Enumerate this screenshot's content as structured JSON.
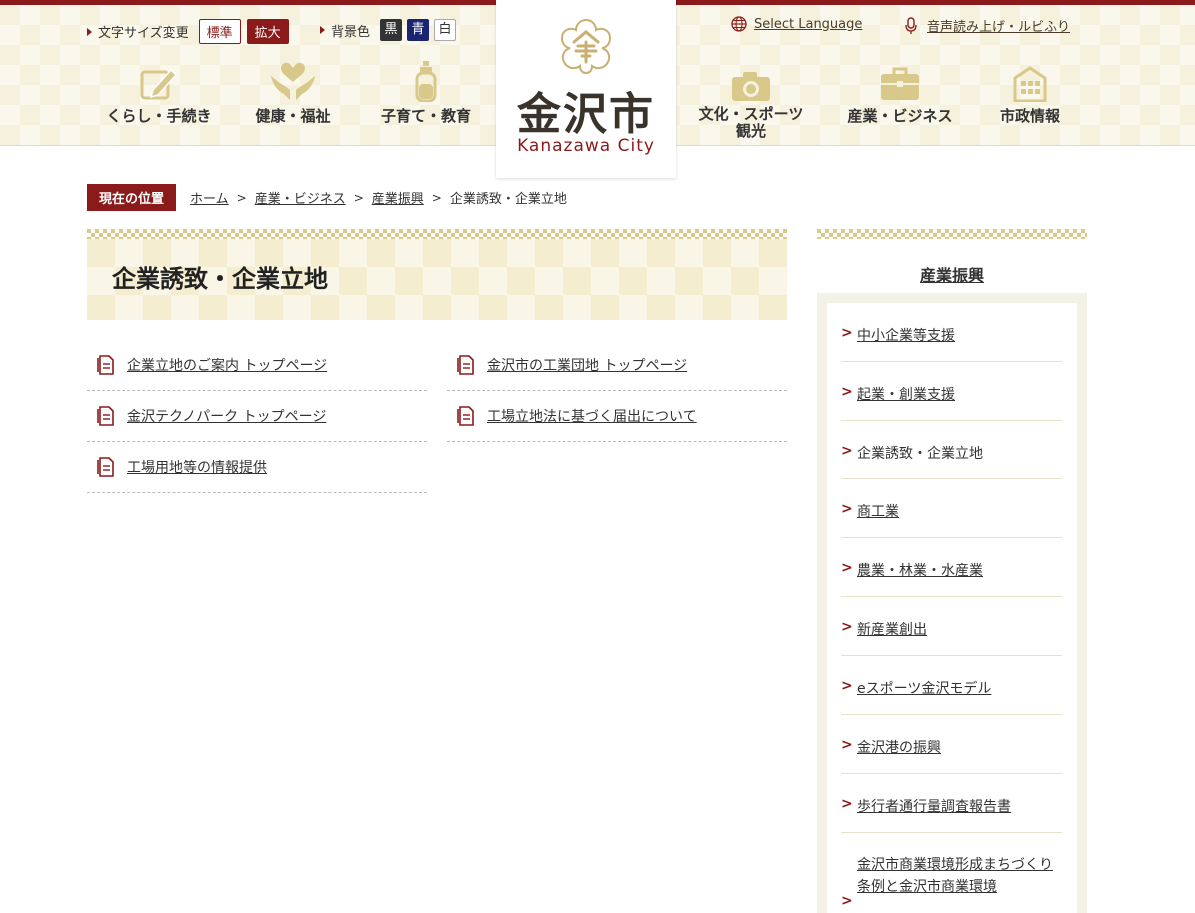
{
  "colors": {
    "accent": "#8b1a1a",
    "navy": "#1a2470",
    "gold": "#d8c88a"
  },
  "header": {
    "font_size_label": "文字サイズ変更",
    "font_size_standard": "標準",
    "font_size_large": "拡大",
    "bg_color_label": "背景色",
    "bg_black": "黒",
    "bg_blue": "青",
    "bg_white": "白",
    "select_language": "Select Language",
    "voice_reading": "音声読み上げ・ルビふり",
    "logo_name": "金沢市",
    "logo_sub": "Kanazawa City",
    "nav": [
      {
        "label": "くらし・手続き",
        "icon": "pencil-note-icon"
      },
      {
        "label": "健康・福祉",
        "icon": "hands-heart-icon"
      },
      {
        "label": "子育て・教育",
        "icon": "baby-bottle-icon"
      },
      {
        "label": "文化・スポーツ",
        "label2": "観光",
        "icon": "camera-icon"
      },
      {
        "label": "産業・ビジネス",
        "icon": "briefcase-icon"
      },
      {
        "label": "市政情報",
        "icon": "building-icon"
      }
    ]
  },
  "breadcrumb": {
    "tag": "現在の位置",
    "items": [
      "ホーム",
      "産業・ビジネス",
      "産業振興"
    ],
    "current": "企業誘致・企業立地",
    "sep": ">"
  },
  "page_title": "企業誘致・企業立地",
  "links": [
    "企業立地のご案内 トップページ",
    "金沢市の工業団地 トップページ",
    "金沢テクノパーク トップページ",
    "工場立地法に基づく届出について",
    "工場用地等の情報提供"
  ],
  "sidebar": {
    "title": "産業振興",
    "items": [
      {
        "label": "中小企業等支援"
      },
      {
        "label": "起業・創業支援"
      },
      {
        "label": "企業誘致・企業立地"
      },
      {
        "label": "商工業"
      },
      {
        "label": "農業・林業・水産業"
      },
      {
        "label": "新産業創出"
      },
      {
        "label": "eスポーツ金沢モデル"
      },
      {
        "label": "金沢港の振興"
      },
      {
        "label": "歩行者通行量調査報告書"
      },
      {
        "label": "金沢市商業環境形成まちづくり条例と金沢市商業環境"
      }
    ],
    "chevron": ">"
  }
}
